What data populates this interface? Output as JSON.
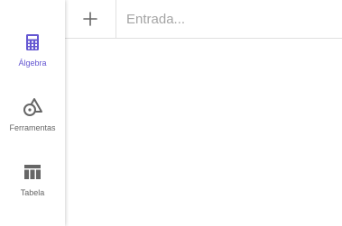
{
  "sidebar": {
    "items": [
      {
        "label": "Álgebra",
        "icon": "calculator-icon",
        "active": true
      },
      {
        "label": "Ferramentas",
        "icon": "shapes-tools-icon",
        "active": false
      },
      {
        "label": "Tabela",
        "icon": "table-icon",
        "active": false
      }
    ]
  },
  "algebra": {
    "add_icon": "plus-icon",
    "input": {
      "value": "",
      "placeholder": "Entrada..."
    }
  },
  "colors": {
    "accent": "#6557d2",
    "icon_gray": "#666666",
    "placeholder": "#a5a5a5",
    "divider": "#e0e0e0"
  }
}
